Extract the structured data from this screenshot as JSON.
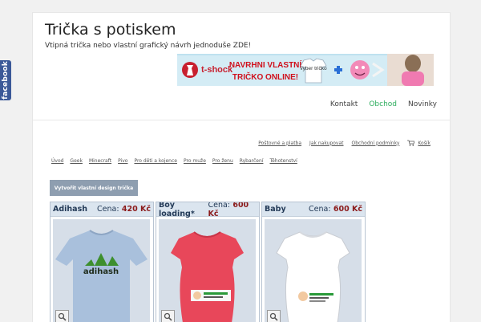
{
  "site": {
    "title": "Trička s potiskem",
    "description": "Vtipná trička nebo vlastní grafický návrh jednoduše ZDE!"
  },
  "facebook_tab": {
    "label": "facebook"
  },
  "banner": {
    "brand": "t-shock",
    "line1": "NAVRHNI VLASTNÍ",
    "line2": "TRIČKO ONLINE!",
    "shirt_label": "vyber tričko"
  },
  "main_nav": [
    "Kontakt",
    "Obchod",
    "Novinky"
  ],
  "shop_links": [
    "Poštovné a platba",
    "Jak nakupovat",
    "Obchodní podmínky",
    "Košík"
  ],
  "categories": [
    "Úvod",
    "Geek",
    "Minecraft",
    "Pivo",
    "Pro děti a kojence",
    "Pro muže",
    "Pro ženu",
    "Rybarčení",
    "Těhotenství"
  ],
  "create_button": "Vytvořit vlastní design trička",
  "products": [
    {
      "name": "Adihash",
      "price_label": "Cena:",
      "price": "420 Kč",
      "print_text": "adihash",
      "shirt_color": "#a9c0dc"
    },
    {
      "name": "Boy loading*",
      "price_label": "Cena:",
      "price": "600 Kč",
      "shirt_color": "#e8475a"
    },
    {
      "name": "Baby",
      "price_label": "Cena:",
      "price": "600 Kč",
      "shirt_color": "#ffffff"
    }
  ],
  "colors": {
    "accent_green": "#2fae5f",
    "facebook_blue": "#3b5998",
    "card_header": "#dbe5ef",
    "price_red": "#8b1a1a"
  }
}
